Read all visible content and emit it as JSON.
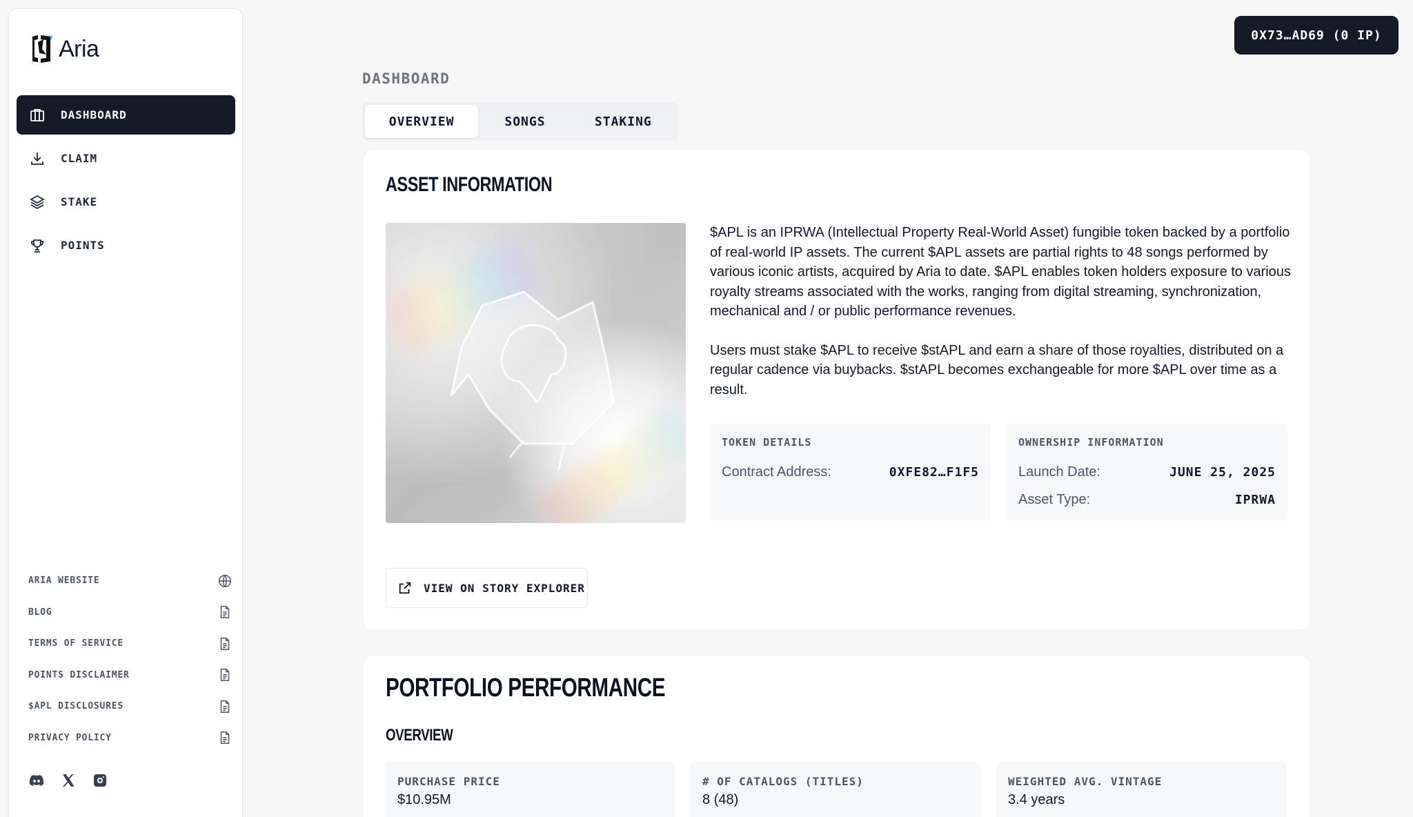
{
  "brand": {
    "name": "Aria"
  },
  "wallet": {
    "label": "0X73…AD69 (0 IP)"
  },
  "nav": [
    {
      "label": "DASHBOARD",
      "icon": "dashboard-icon",
      "active": true
    },
    {
      "label": "CLAIM",
      "icon": "download-icon"
    },
    {
      "label": "STAKE",
      "icon": "layers-icon"
    },
    {
      "label": "POINTS",
      "icon": "trophy-icon"
    }
  ],
  "footer_links": [
    {
      "label": "ARIA WEBSITE",
      "icon": "globe-icon"
    },
    {
      "label": "BLOG",
      "icon": "document-icon"
    },
    {
      "label": "TERMS OF SERVICE",
      "icon": "document-icon"
    },
    {
      "label": "POINTS DISCLAIMER",
      "icon": "document-icon"
    },
    {
      "label": "$APL DISCLOSURES",
      "icon": "document-icon"
    },
    {
      "label": "PRIVACY POLICY",
      "icon": "document-icon"
    }
  ],
  "socials": [
    "discord-icon",
    "x-icon",
    "instagram-icon"
  ],
  "page": {
    "title": "DASHBOARD"
  },
  "tabs": [
    {
      "label": "OVERVIEW",
      "active": true
    },
    {
      "label": "SONGS"
    },
    {
      "label": "STAKING"
    }
  ],
  "asset": {
    "title": "ASSET INFORMATION",
    "paragraph1": "$APL is an IPRWA (Intellectual Property Real-World Asset) fungible token backed by a portfolio of real-world IP assets. The current $APL assets are partial rights to 48 songs performed by various iconic artists, acquired by Aria to date. $APL enables token holders exposure to various royalty streams associated with the works, ranging from digital streaming, synchronization, mechanical and / or public performance revenues.",
    "paragraph2": "Users must stake $APL to receive $stAPL and earn a share of those royalties, distributed on a regular cadence via buybacks. $stAPL becomes exchangeable for more $APL over time as a result.",
    "token_details": {
      "label": "TOKEN DETAILS",
      "contract_key": "Contract Address:",
      "contract_val": "0XFE82…F1F5"
    },
    "ownership": {
      "label": "OWNERSHIP INFORMATION",
      "launch_key": "Launch Date:",
      "launch_val": "JUNE 25, 2025",
      "type_key": "Asset Type:",
      "type_val": "IPRWA"
    },
    "explorer_button": "VIEW ON STORY EXPLORER"
  },
  "portfolio": {
    "title": "PORTFOLIO PERFORMANCE",
    "subtitle": "OVERVIEW",
    "stats": [
      {
        "label": "PURCHASE PRICE",
        "value": "$10.95M"
      },
      {
        "label": "# OF CATALOGS (TITLES)",
        "value": "8 (48)"
      },
      {
        "label": "WEIGHTED AVG. VINTAGE",
        "value": "3.4 years"
      }
    ]
  },
  "colors": {
    "primary_dark": "#141a26",
    "background": "#f7f7f7",
    "card": "#ffffff",
    "panel": "#f7f8f9"
  }
}
